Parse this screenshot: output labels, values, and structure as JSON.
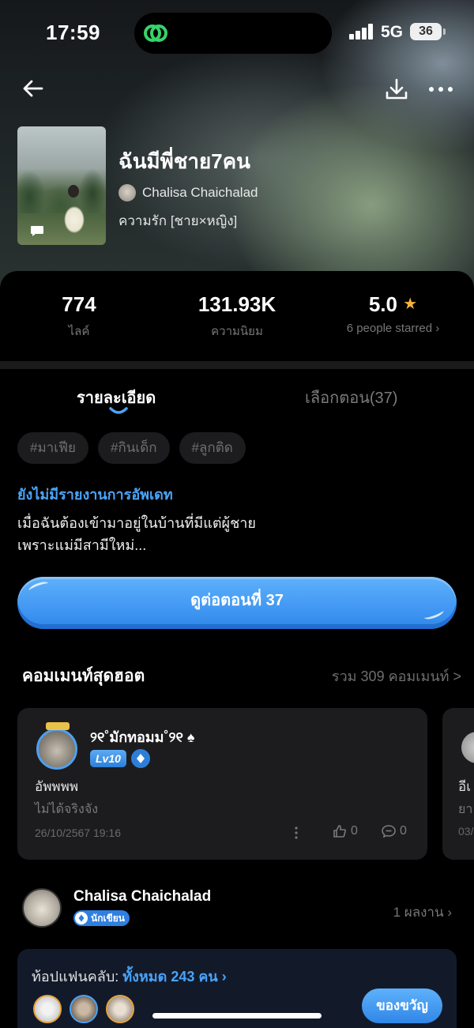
{
  "status_bar": {
    "time": "17:59",
    "network": "5G",
    "battery": "36"
  },
  "novel": {
    "title": "ฉันมีพี่ชาย7คน",
    "author": "Chalisa Chaichalad",
    "genre": "ความรัก [ชาย×หญิง]"
  },
  "stats": {
    "likes_value": "774",
    "likes_label": "ไลค์",
    "popularity_value": "131.93K",
    "popularity_label": "ความนิยม",
    "rating_value": "5.0",
    "rating_label": "6 people starred ›"
  },
  "tabs": {
    "details": "รายละเอียด",
    "chapters": "เลือกตอน(37)"
  },
  "tags": [
    "#มาเฟีย",
    "#กินเด็ก",
    "#ลูกติด"
  ],
  "update_note": "ยังไม่มีรายงานการอัพเดท",
  "synopsis_line1": "เมื่อฉันต้องเข้ามาอยู่ในบ้านที่มีแต่ผู้ชาย",
  "synopsis_line2": "เพราะแม่มีสามีใหม่...",
  "continue_button": "ดูต่อตอนที่ 37",
  "comments_section": {
    "title": "คอมเมนท์สุดฮอต",
    "total_link": "รวม 309 คอมเมนท์ >"
  },
  "comment": {
    "username": "୨୧˚มักทอมม˚୨୧ ♠",
    "level": "Lv10",
    "text": "อัพพพพ",
    "subtext": "ไม่ได้จริงจัง",
    "date": "26/10/2567 19:16",
    "likes": "0",
    "replies": "0"
  },
  "comment_peek": {
    "text": "อีเ",
    "subtext": "ยา",
    "date": "03/"
  },
  "author_section": {
    "name": "Chalisa Chaichalad",
    "badge": "นักเขียน",
    "works": "1 ผลงาน  ›"
  },
  "fan_club": {
    "title": "ท้อปแฟนคลับ:",
    "link": "ทั้งหมด 243 คน ›",
    "gift_button": "ของขวัญ"
  },
  "colors": {
    "accent": "#4aa3f7",
    "background": "#000000",
    "card": "#1c1c1e",
    "star": "#f3b53a"
  }
}
